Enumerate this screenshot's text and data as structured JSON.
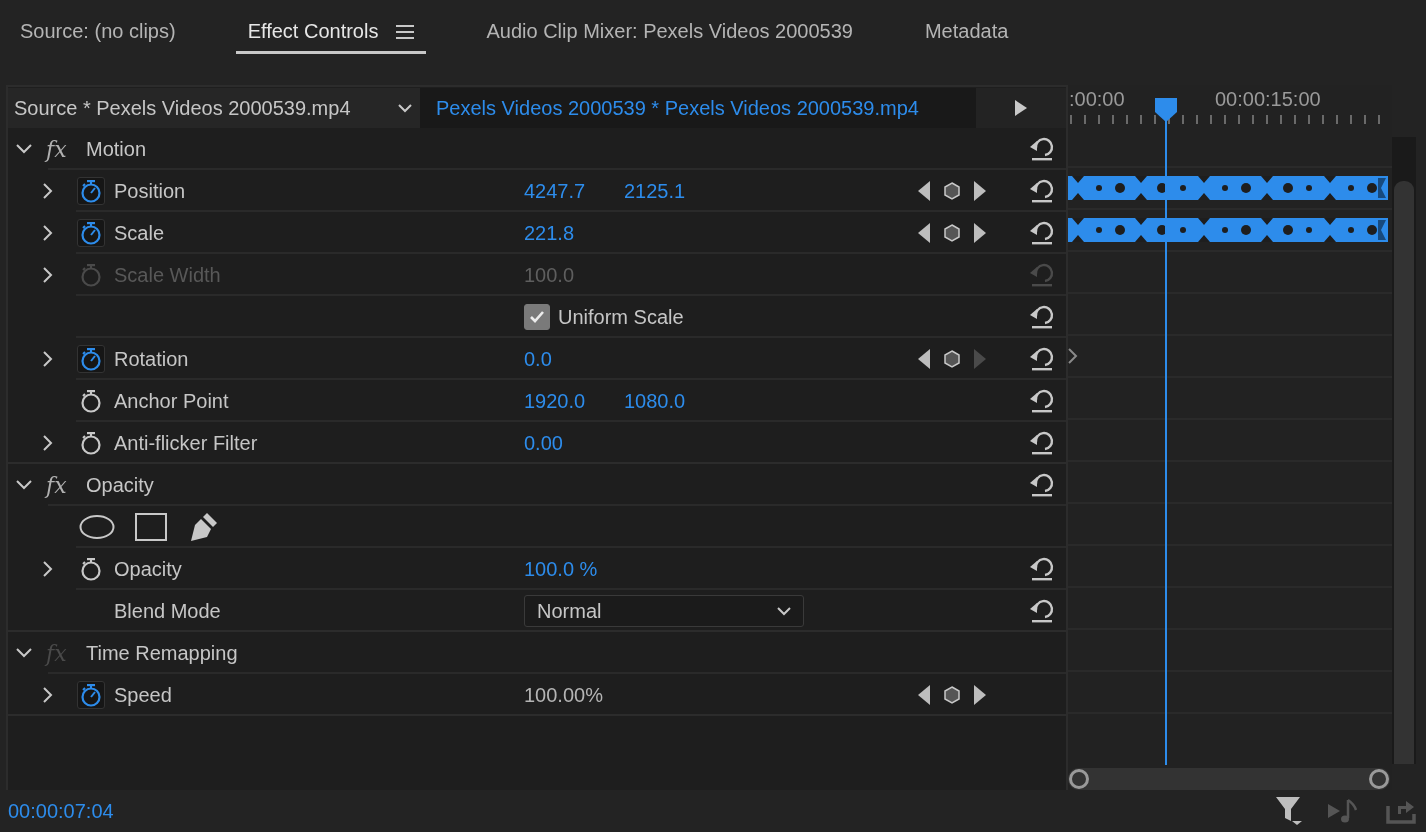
{
  "tabs": [
    {
      "label": "Source: (no clips)",
      "selected": false,
      "menu": false
    },
    {
      "label": "Effect Controls",
      "selected": true,
      "menu": true
    },
    {
      "label": "Audio Clip Mixer: Pexels Videos 2000539",
      "selected": false,
      "menu": false
    },
    {
      "label": "Metadata",
      "selected": false,
      "menu": false
    }
  ],
  "clip_header": {
    "source": "Source * Pexels Videos 2000539.mp4",
    "sequence": "Pexels Videos 2000539 * Pexels Videos 2000539.mp4"
  },
  "ruler": {
    "labels": [
      ":00:00",
      "00:00:15:00"
    ]
  },
  "effects": [
    {
      "name": "Motion",
      "fx": "fx",
      "enabled": true,
      "expanded": true,
      "reset": true,
      "properties": [
        {
          "kind": "param",
          "name": "Position",
          "expandable": true,
          "animated": true,
          "disabled": false,
          "values": [
            "4247.7",
            "2125.1"
          ],
          "values_editable": true,
          "keyframe_nav": {
            "next_enabled": true
          },
          "reset": true,
          "keyframes": true,
          "offscreen_keyframe": false
        },
        {
          "kind": "param",
          "name": "Scale",
          "expandable": true,
          "animated": true,
          "disabled": false,
          "values": [
            "221.8"
          ],
          "values_editable": true,
          "keyframe_nav": {
            "next_enabled": true
          },
          "reset": true,
          "keyframes": true,
          "offscreen_keyframe": false
        },
        {
          "kind": "param",
          "name": "Scale Width",
          "expandable": true,
          "animated": false,
          "disabled": true,
          "values": [
            "100.0"
          ],
          "values_editable": true,
          "reset": true,
          "keyframes": false,
          "offscreen_keyframe": false
        },
        {
          "kind": "checkbox",
          "label": "Uniform Scale",
          "checked": true,
          "reset": true,
          "keyframes": false,
          "offscreen_keyframe": false
        },
        {
          "kind": "param",
          "name": "Rotation",
          "expandable": true,
          "animated": true,
          "disabled": false,
          "values": [
            "0.0"
          ],
          "values_editable": true,
          "keyframe_nav": {
            "next_enabled": false
          },
          "reset": true,
          "keyframes": false,
          "offscreen_keyframe": true
        },
        {
          "kind": "param",
          "name": "Anchor Point",
          "expandable": false,
          "animated": false,
          "disabled": false,
          "values": [
            "1920.0",
            "1080.0"
          ],
          "values_editable": true,
          "reset": true,
          "keyframes": false,
          "offscreen_keyframe": false
        },
        {
          "kind": "param",
          "name": "Anti-flicker Filter",
          "expandable": true,
          "animated": false,
          "disabled": false,
          "values": [
            "0.00"
          ],
          "values_editable": true,
          "reset": true,
          "keyframes": false,
          "offscreen_keyframe": false
        }
      ]
    },
    {
      "name": "Opacity",
      "fx": "fx",
      "enabled": true,
      "expanded": true,
      "reset": true,
      "properties": [
        {
          "kind": "masks",
          "keyframes": false,
          "offscreen_keyframe": false
        },
        {
          "kind": "param",
          "name": "Opacity",
          "expandable": true,
          "animated": false,
          "disabled": false,
          "values": [
            "100.0 %"
          ],
          "values_editable": true,
          "reset": true,
          "keyframes": false,
          "offscreen_keyframe": false
        },
        {
          "kind": "dropdown",
          "name": "Blend Mode",
          "value": "Normal",
          "reset": true,
          "keyframes": false,
          "offscreen_keyframe": false
        }
      ]
    },
    {
      "name": "Time Remapping",
      "fx": "fx",
      "enabled": false,
      "expanded": true,
      "reset": false,
      "properties": [
        {
          "kind": "param",
          "name": "Speed",
          "expandable": true,
          "animated": true,
          "disabled": false,
          "values": [
            "100.00%"
          ],
          "values_editable": false,
          "keyframe_nav": {
            "next_enabled": true
          },
          "reset": false,
          "keyframes": false,
          "offscreen_keyframe": false
        }
      ]
    }
  ],
  "current_time": "00:00:07:04"
}
